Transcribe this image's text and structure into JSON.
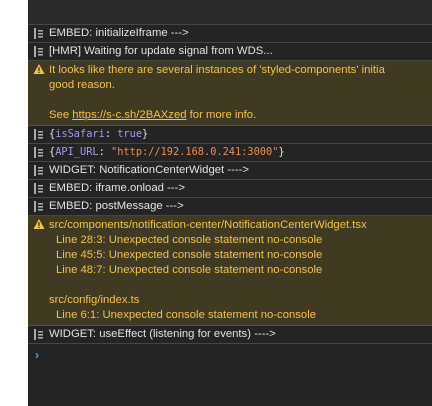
{
  "console": {
    "messages": [
      {
        "text": "EMBED: initializeIframe --->"
      },
      {
        "text": "[HMR] Waiting for update signal from WDS..."
      },
      {
        "line1": "It looks like there are several instances of 'styled-components' initia",
        "line2": "good reason.",
        "see_prefix": "See ",
        "link": "https://s-c.sh/2BAXzed",
        "see_suffix": " for more info."
      },
      {
        "open": "{",
        "key": "isSafari",
        "sep": ": ",
        "value": "true",
        "close": "}"
      },
      {
        "open": "{",
        "key": "API_URL",
        "sep": ": ",
        "value": "\"http://192.168.0.241:3000\"",
        "close": "}"
      },
      {
        "text": "WIDGET: NotificationCenterWidget ---->"
      },
      {
        "text": "EMBED: iframe.onload --->"
      },
      {
        "text": "EMBED: postMessage --->"
      },
      {
        "file1": "src/components/notification-center/NotificationCenterWidget.tsx",
        "lines1": [
          "Line 28:3:  Unexpected console statement  no-console",
          "Line 45:5:  Unexpected console statement  no-console",
          "Line 48:7:  Unexpected console statement  no-console"
        ],
        "file2": "src/config/index.ts",
        "lines2": [
          "Line 6:1:  Unexpected console statement  no-console"
        ]
      },
      {
        "text": "WIDGET: useEffect (listening for events) ---->"
      }
    ],
    "prompt": "›"
  },
  "colors": {
    "background": "#242424",
    "warning_bg": "#413a22",
    "warning_text": "#f2c24a",
    "key": "#9f9cf5",
    "string": "#f28b54",
    "prompt": "#4ba3f5"
  }
}
